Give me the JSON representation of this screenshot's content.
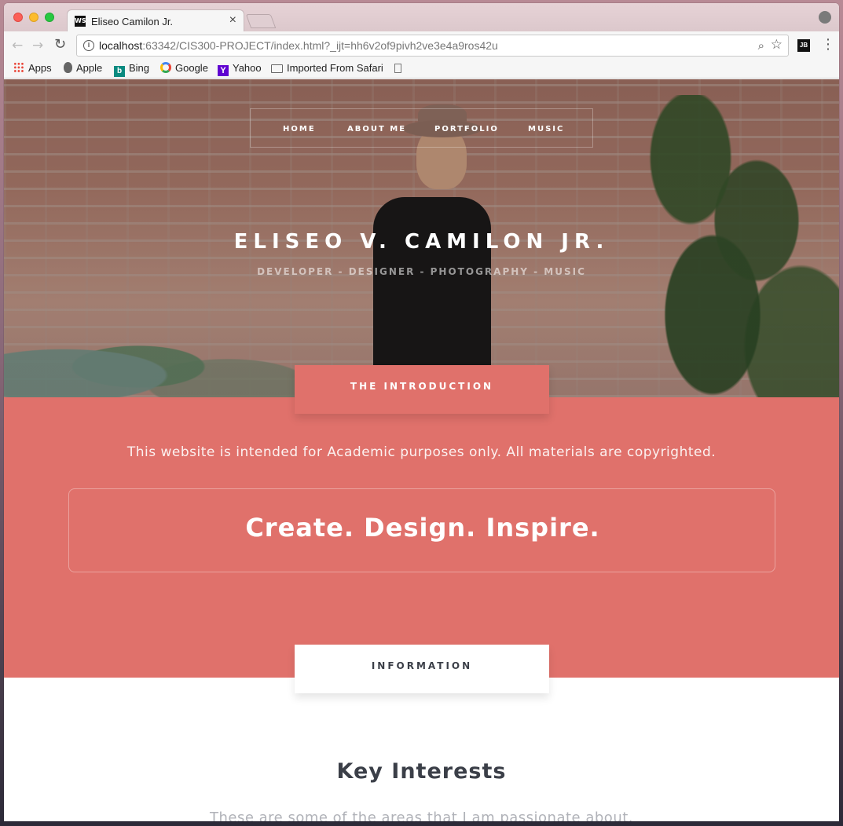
{
  "browser": {
    "tab_title": "Eliseo Camilon Jr.",
    "tab_favicon": "WS",
    "tab_close": "×",
    "url_host": "localhost",
    "url_rest": ":63342/CIS300-PROJECT/index.html?_ijt=hh6v2of9pivh2ve3e4a9ros42u",
    "extension_label": "JB",
    "bookmarks": [
      {
        "label": "Apps",
        "icon": "apps-icon"
      },
      {
        "label": "Apple",
        "icon": "apple-icon"
      },
      {
        "label": "Bing",
        "icon": "bing-icon"
      },
      {
        "label": "Google",
        "icon": "google-icon"
      },
      {
        "label": "Yahoo",
        "icon": "yahoo-icon"
      },
      {
        "label": "Imported From Safari",
        "icon": "folder-icon"
      }
    ]
  },
  "site": {
    "nav": [
      "HOME",
      "ABOUT ME",
      "PORTFOLIO",
      "MUSIC"
    ],
    "hero_title": "ELISEO V. CAMILON JR.",
    "hero_subtitle": "DEVELOPER - DESIGNER - PHOTOGRAPHY - MUSIC",
    "intro_tab": "THE INTRODUCTION",
    "intro_text": "This website is intended for Academic purposes only. All materials are copyrighted.",
    "motto": "Create. Design. Inspire.",
    "info_tab": "INFORMATION",
    "key_title": "Key Interests",
    "key_subtitle": "These are some of the areas that I am passionate about."
  },
  "colors": {
    "accent": "#e0716b",
    "heading": "#3b3f48"
  }
}
